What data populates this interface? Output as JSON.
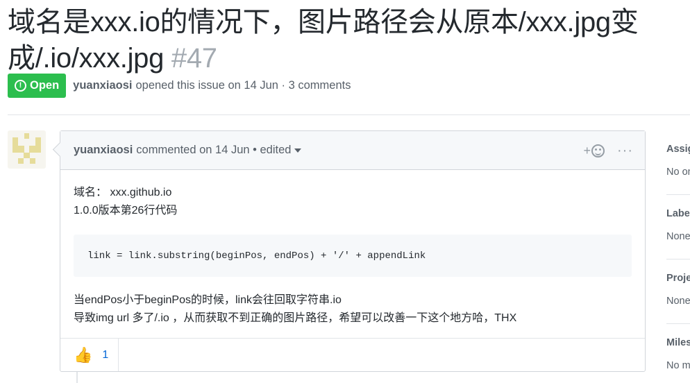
{
  "issue": {
    "title": "域名是xxx.io的情况下，图片路径会从原本/xxx.jpg变成/.io/xxx.jpg",
    "number": "#47",
    "state_label": "Open",
    "author": "yuanxiaosi",
    "meta_text": "opened this issue on 14 Jun · 3 comments"
  },
  "comment": {
    "author": "yuanxiaosi",
    "meta_text": "commented on 14 Jun • edited",
    "react_plus": "+",
    "more": "···",
    "body": {
      "line1": "域名： xxx.github.io",
      "line2": "1.0.0版本第26行代码",
      "code": "link = link.substring(beginPos, endPos) + '/' + appendLink",
      "line3": "当endPos小于beginPos的时候，link会往回取字符串.io",
      "line4": "导致img url 多了/.io ，从而获取不到正确的图片路径，希望可以改善一下这个地方哈，THX"
    },
    "reactions": [
      {
        "icon": "thumbs-up-icon",
        "glyph": "👍",
        "count": "1"
      }
    ]
  },
  "sidebar": {
    "items": [
      {
        "heading": "Assignees",
        "value": "No one"
      },
      {
        "heading": "Labels",
        "value": "None"
      },
      {
        "heading": "Projects",
        "value": "None"
      },
      {
        "heading": "Milestone",
        "value": "No milestone"
      }
    ]
  },
  "colors": {
    "open_green": "#2cbe4e",
    "link_blue": "#0366d6",
    "muted_text": "#586069"
  }
}
